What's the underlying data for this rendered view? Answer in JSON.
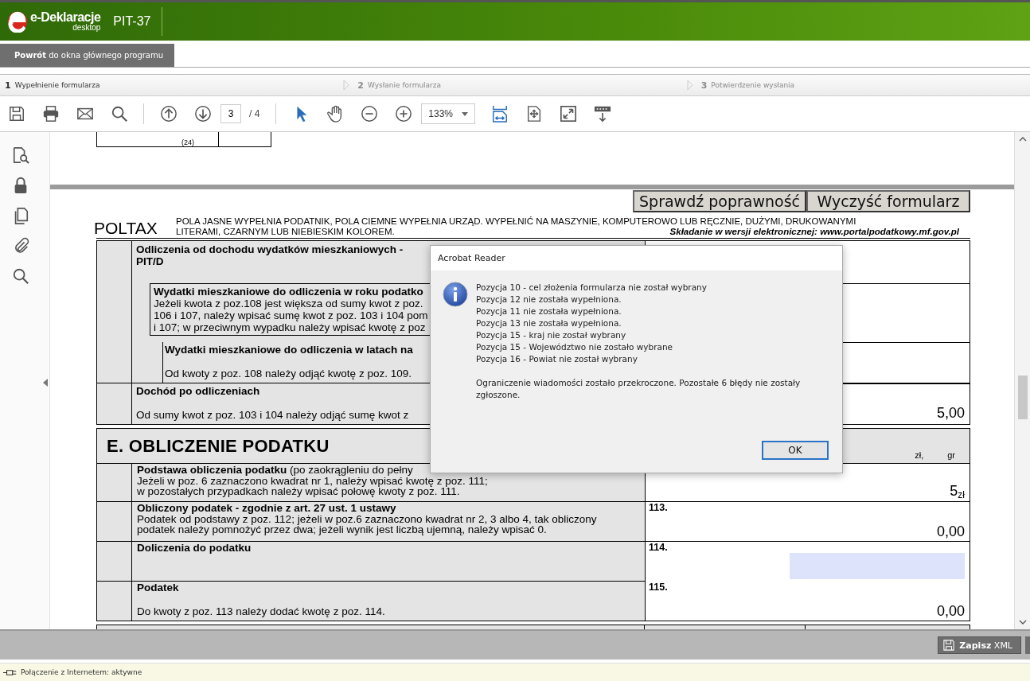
{
  "app": {
    "logo_name": "e-Deklaracje",
    "logo_sub": "desktop",
    "form_title": "PIT-37"
  },
  "back_button": "**Powrót** do okna głównego programu",
  "steps": [
    {
      "number": "1",
      "label": "Wypełnienie formularza",
      "selected": true
    },
    {
      "number": "2",
      "label": "Wysłanie formularza",
      "selected": false
    },
    {
      "number": "3",
      "label": "Potwierdzenie wysłania",
      "selected": false
    }
  ],
  "toolbar": {
    "page": "3",
    "page_total": "/ 4",
    "zoom": "133%",
    "select_tool": {
      "selected": true
    },
    "hand_tool": {
      "selected": false
    },
    "fit_width": {
      "selected": true
    }
  },
  "document": {
    "form_code_suffix": "(24)",
    "buttons": [
      "Sprawdź poprawność",
      "Wyczyść formularz"
    ],
    "poltax": "POLTAX",
    "instructions": [
      "POLA JASNE WYPEŁNIA PODATNIK, POLA CIEMNE WYPEŁNIA URZĄD. WYPEŁNIĆ NA MASZYNIE, KOMPUTEROWO LUB RĘCZNIE, DUŻYMI, DRUKOWANYMI",
      "LITERAMI, CZARNYM LUB NIEBIESKIM KOLOREM."
    ],
    "electronic_note": "Składanie w wersji elektronicznej: www.portalpodatkowy.mf.gov.pl",
    "section_d": [
      {
        "kind": "heading",
        "title": "Odliczenia od dochodu wydatków mieszkaniowych -",
        "lines": [
          "PIT/D"
        ]
      },
      {
        "kind": "boxed",
        "title": "Wydatki mieszkaniowe do odliczenia w roku podatko",
        "lines": [
          "Jeżeli kwota z poz.108 jest większa od sumy kwot z poz.",
          "106 i 107, należy wpisać sumę kwot z poz. 103 i 104 pom",
          "i 107; w przeciwnym wypadku należy wpisać kwotę z poz"
        ]
      },
      {
        "kind": "indented",
        "title": "Wydatki mieszkaniowe do odliczenia w latach na",
        "lines": [
          "Od kwoty z poz. 108 należy odjąć kwotę z poz. 109."
        ]
      },
      {
        "kind": "plain",
        "title": "Dochód po odliczeniach",
        "lines": [
          "Od sumy kwot z poz. 103 i 104 należy odjąć sumę kwot z"
        ],
        "value": "5,00"
      }
    ],
    "section_e": {
      "title": "E. OBLICZENIE PODATKU",
      "units": [
        "zł,",
        "gr"
      ],
      "rows": [
        {
          "kind": "value",
          "title": "**Podstawa obliczenia podatku** (po zaokrągleniu do pełny",
          "bold_title": false,
          "lines": [
            "Jeżeli w poz. 6 zaznaczono kwadrat nr 1, należy wpisać kwotę z poz. 111;",
            "w pozostałych przypadkach należy wpisać połowę kwoty z poz. 111."
          ],
          "value": "5$_{zł}$"
        },
        {
          "kind": "value",
          "title": "Obliczony podatek - zgodnie z art. 27 ust. 1 ustawy",
          "bold_title": true,
          "lines": [
            "Podatek od podstawy z poz. 112; jeżeli w poz.6 zaznaczono kwadrat nr 2, 3 albo 4, tak obliczony",
            "podatek należy pomnożyć przez dwa; jeżeli wynik jest liczbą ujemną, należy wpisać 0."
          ],
          "field_no": "113.",
          "value": "0,00"
        },
        {
          "kind": "input",
          "title": "Doliczenia do podatku",
          "bold_title": true,
          "lines": [],
          "field_no": "114."
        },
        {
          "kind": "value",
          "title": "Podatek",
          "bold_title": true,
          "lines": [
            "Do kwoty z poz. 113 należy dodać kwotę z poz. 114."
          ],
          "field_no": "115.",
          "value": "0,00"
        }
      ]
    }
  },
  "dialog": {
    "title": "Acrobat Reader",
    "messages": [
      "Pozycja 10 - cel złożenia formularza nie został wybrany",
      "Pozycja 12 nie została wypełniona.",
      "Pozycja 11 nie została wypełniona.",
      "Pozycja 13 nie została wypełniona.",
      "Pozycja 15 - kraj nie został wybrany",
      "Pozycja 15 - Województwo nie zostało wybrane",
      "Pozycja 16 - Powiat nie został wybrany"
    ],
    "note": "Ograniczenie wiadomości zostało przekroczone. Pozostałe 6 błędy nie zostały zgłoszone.",
    "button": "OK"
  },
  "save_button": "**Zapisz** XML",
  "status_bar": "Połączenie z Internetem: aktywne"
}
